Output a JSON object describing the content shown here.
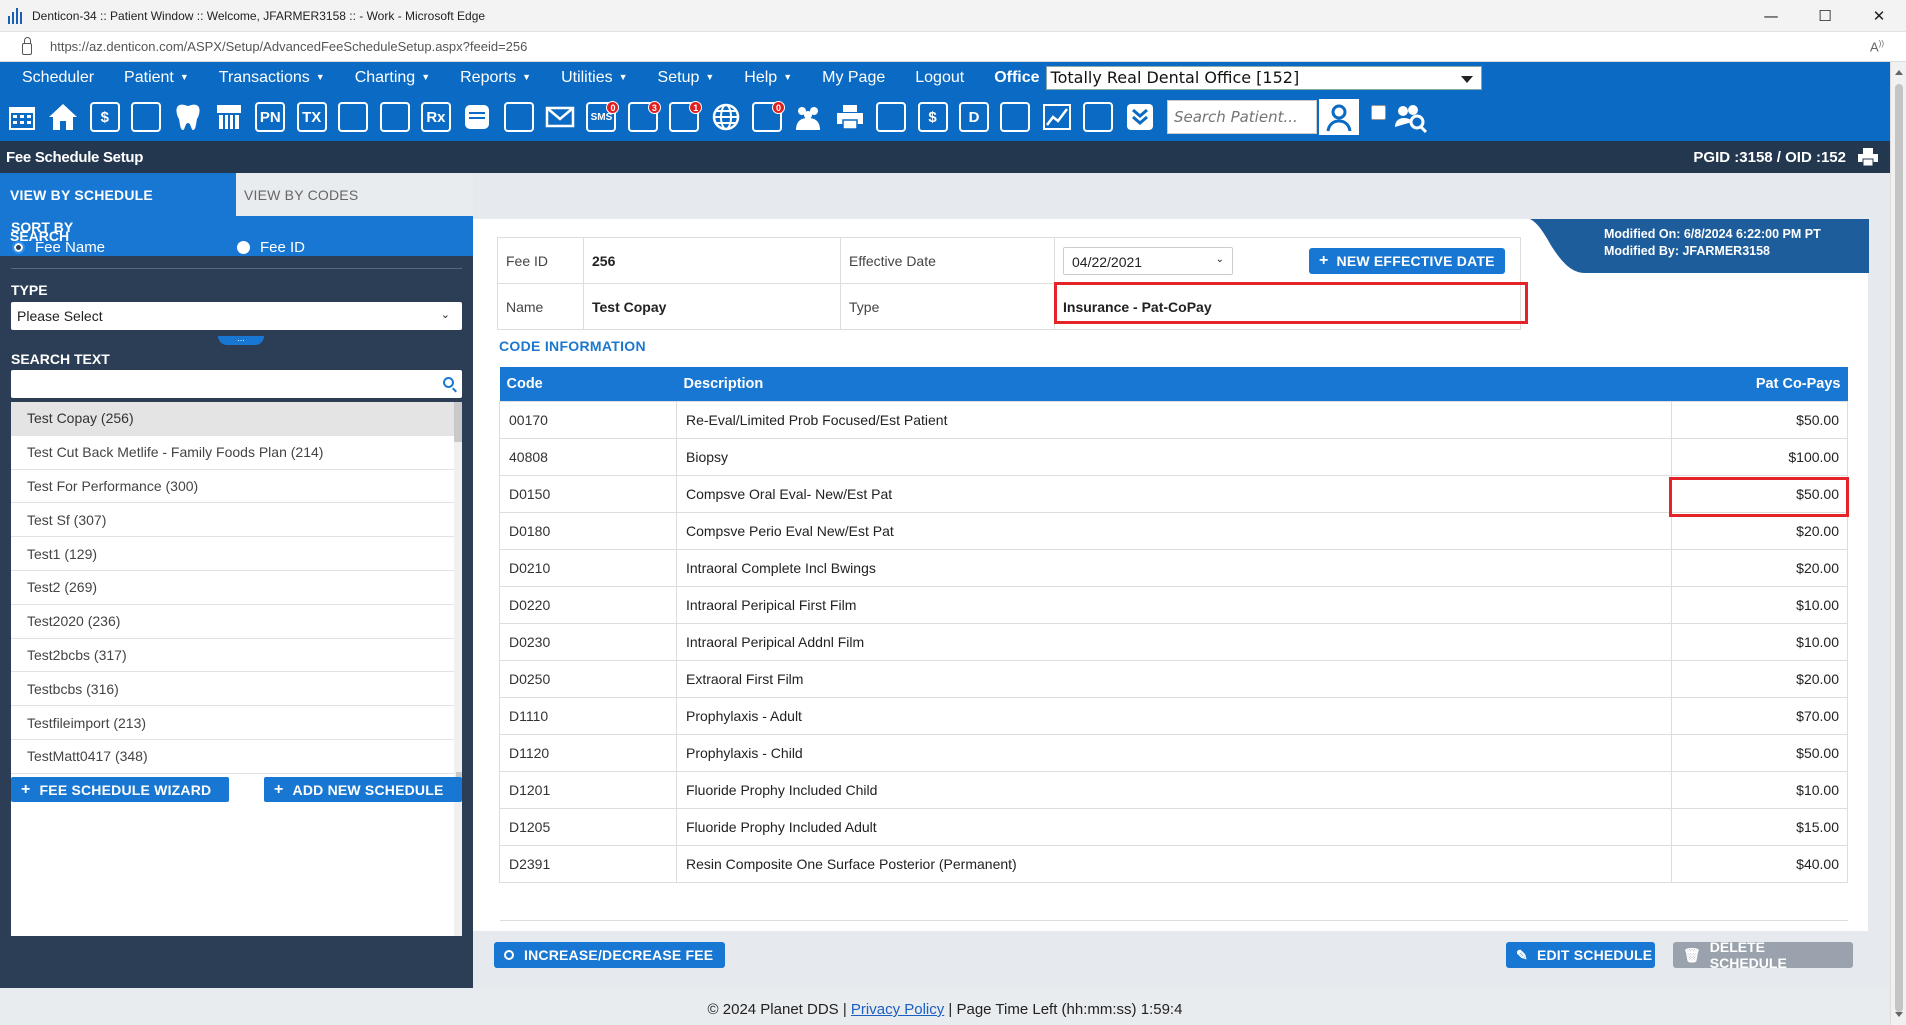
{
  "window": {
    "title": "Denticon-34 :: Patient Window :: Welcome, JFARMER3158 :: - Work - Microsoft Edge",
    "url": "https://az.denticon.com/ASPX/Setup/AdvancedFeeScheduleSetup.aspx?feeid=256",
    "controls": {
      "minimize": "—",
      "maximize": "☐",
      "close": "✕"
    },
    "readaloud": "A̩"
  },
  "menu": {
    "items": [
      "Scheduler",
      "Patient",
      "Transactions",
      "Charting",
      "Reports",
      "Utilities",
      "Setup",
      "Help",
      "My Page",
      "Logout"
    ],
    "office_label": "Office",
    "office_value": "Totally Real Dental Office [152]"
  },
  "toolbar": {
    "icons": [
      {
        "name": "calendar-icon",
        "text": ""
      },
      {
        "name": "home-icon",
        "text": ""
      },
      {
        "name": "dollar-icon",
        "text": "$"
      },
      {
        "name": "edit-list-icon",
        "text": ""
      },
      {
        "name": "tooth-icon",
        "text": ""
      },
      {
        "name": "teeth-icon",
        "text": ""
      },
      {
        "name": "pn-icon",
        "text": "PN"
      },
      {
        "name": "tx-icon",
        "text": "TX"
      },
      {
        "name": "add-patient-icon",
        "text": ""
      },
      {
        "name": "add-group-icon",
        "text": ""
      },
      {
        "name": "rx-icon",
        "text": "Rx"
      },
      {
        "name": "notes-icon",
        "text": ""
      },
      {
        "name": "scanner-icon",
        "text": ""
      },
      {
        "name": "mail-icon",
        "text": ""
      },
      {
        "name": "sms-icon",
        "text": "SMS",
        "badge": "0"
      },
      {
        "name": "globe-users-icon",
        "text": "",
        "badge": "3"
      },
      {
        "name": "support-icon",
        "text": "",
        "badge": "1"
      },
      {
        "name": "globe-icon",
        "text": ""
      },
      {
        "name": "forms-icon",
        "text": "",
        "badge": "0"
      },
      {
        "name": "group-icon",
        "text": ""
      },
      {
        "name": "printer-icon",
        "text": ""
      },
      {
        "name": "shield-arrow-icon",
        "text": ""
      },
      {
        "name": "money-shield-icon",
        "text": "$"
      },
      {
        "name": "document-d-icon",
        "text": "D"
      },
      {
        "name": "network-icon",
        "text": ""
      },
      {
        "name": "chart-line-icon",
        "text": ""
      },
      {
        "name": "world-user-icon",
        "text": ""
      },
      {
        "name": "download-shield-icon",
        "text": ""
      }
    ],
    "search_placeholder": "Search Patient..."
  },
  "header": {
    "title": "Fee Schedule Setup",
    "pgid": "PGID :3158  /  OID :152"
  },
  "left": {
    "tabs": [
      "VIEW BY SCHEDULE",
      "VIEW BY CODES"
    ],
    "search_heading": "SEARCH",
    "sort_by_label": "SORT BY",
    "sort_options": [
      "Fee Name",
      "Fee ID"
    ],
    "type_label": "TYPE",
    "type_value": "Please Select",
    "search_text_label": "SEARCH TEXT",
    "schedules": [
      "Test Copay (256)",
      "Test Cut Back Metlife - Family Foods Plan (214)",
      "Test For Performance (300)",
      "Test Sf (307)",
      "Test1 (129)",
      "Test2 (269)",
      "Test2020 (236)",
      "Test2bcbs (317)",
      "Testbcbs (316)",
      "Testfileimport (213)",
      "TestMatt0417 (348)"
    ],
    "wizard_button": "FEE SCHEDULE WIZARD",
    "add_button": "ADD NEW SCHEDULE"
  },
  "fee": {
    "fee_id_label": "Fee ID",
    "fee_id": "256",
    "effective_date_label": "Effective Date",
    "effective_date": "04/22/2021",
    "new_effective_date_button": "NEW EFFECTIVE DATE",
    "name_label": "Name",
    "name": "Test Copay",
    "type_label": "Type",
    "type": "Insurance - Pat-CoPay",
    "modified_on": "Modified On: 6/8/2024 6:22:00 PM PT",
    "modified_by": "Modified By: JFARMER3158"
  },
  "codes": {
    "section_label": "CODE INFORMATION",
    "headers": [
      "Code",
      "Description",
      "Pat Co-Pays"
    ],
    "rows": [
      [
        "00170",
        "Re-Eval/Limited Prob Focused/Est Patient",
        "$50.00"
      ],
      [
        "40808",
        "Biopsy",
        "$100.00"
      ],
      [
        "D0150",
        "Compsve Oral Eval- New/Est Pat",
        "$50.00"
      ],
      [
        "D0180",
        "Compsve Perio Eval New/Est Pat",
        "$20.00"
      ],
      [
        "D0210",
        "Intraoral Complete Incl Bwings",
        "$20.00"
      ],
      [
        "D0220",
        "Intraoral Peripical First Film",
        "$10.00"
      ],
      [
        "D0230",
        "Intraoral Peripical Addnl Film",
        "$10.00"
      ],
      [
        "D0250",
        "Extraoral First Film",
        "$20.00"
      ],
      [
        "D1110",
        "Prophylaxis - Adult",
        "$70.00"
      ],
      [
        "D1120",
        "Prophylaxis - Child",
        "$50.00"
      ],
      [
        "D1201",
        "Fluoride Prophy Included Child",
        "$10.00"
      ],
      [
        "D1205",
        "Fluoride Prophy Included Adult",
        "$15.00"
      ],
      [
        "D2391",
        "Resin Composite One Surface Posterior (Permanent)",
        "$40.00"
      ]
    ]
  },
  "actions": {
    "increase_decrease": "INCREASE/DECREASE FEE",
    "edit": "EDIT SCHEDULE",
    "delete": "DELETE SCHEDULE"
  },
  "footer": {
    "copyright": "© 2024 Planet DDS | ",
    "privacy": "Privacy Policy",
    "time_left": " | Page Time Left (hh:mm:ss) 1:59:4"
  },
  "colors": {
    "primary": "#1877d2",
    "nav": "#0b6bc4",
    "dark_panel": "#2c3e55",
    "highlight": "#e5242a"
  }
}
